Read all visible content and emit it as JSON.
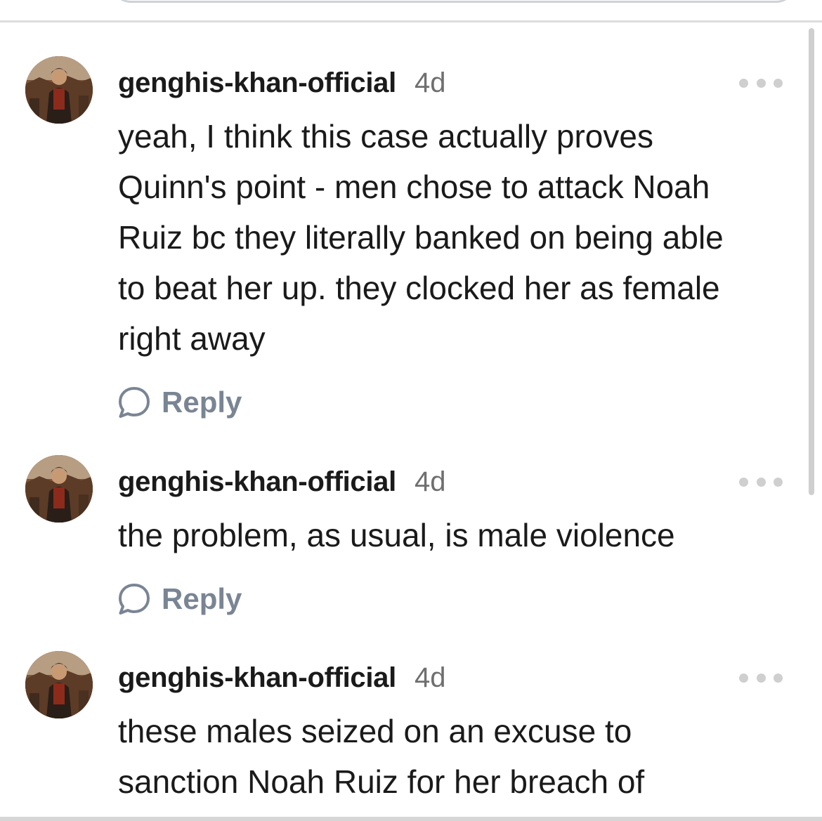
{
  "comments": [
    {
      "username": "genghis-khan-official",
      "timestamp": "4d",
      "text": "yeah, I think this case actually proves\nQuinn's point - men chose to attack Noah\nRuiz bc they literally banked on being able\nto beat her up. they clocked her as female\nright away",
      "reply_label": "Reply"
    },
    {
      "username": "genghis-khan-official",
      "timestamp": "4d",
      "text": "the problem, as usual, is male violence",
      "reply_label": "Reply"
    },
    {
      "username": "genghis-khan-official",
      "timestamp": "4d",
      "text": "these males seized on an excuse to\nsanction Noah Ruiz for her breach of",
      "reply_label": ""
    }
  ],
  "icons": {
    "more": "more-options-icon",
    "reply": "reply-bubble-icon",
    "avatar": "avatar-image"
  },
  "colors": {
    "username": "#1a1a1a",
    "timestamp": "#6f6f6f",
    "reply": "#7a8594",
    "more_dots": "#cfcfcf"
  }
}
